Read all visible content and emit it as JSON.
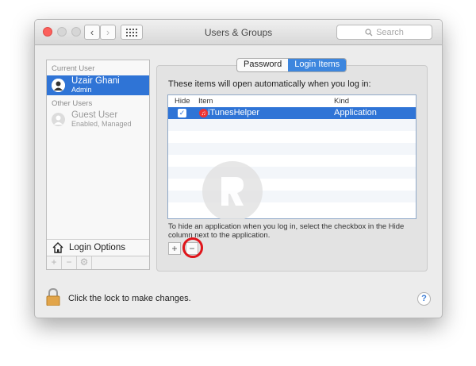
{
  "window": {
    "title": "Users & Groups"
  },
  "toolbar": {
    "search_placeholder": "Search",
    "back_glyph": "‹",
    "forward_glyph": "›",
    "grid_glyph": "⋮⋮⋮"
  },
  "sidebar": {
    "current_user_heading": "Current User",
    "current_user": {
      "name": "Uzair Ghani",
      "role": "Admin"
    },
    "other_users_heading": "Other Users",
    "other_users": [
      {
        "name": "Guest User",
        "role": "Enabled, Managed"
      }
    ],
    "login_options_label": "Login Options",
    "add_glyph": "+",
    "remove_glyph": "−",
    "gear_glyph": "⚙"
  },
  "tabs": [
    {
      "label": "Password",
      "active": false
    },
    {
      "label": "Login Items",
      "active": true
    }
  ],
  "login_items": {
    "intro": "These items will open automatically when you log in:",
    "columns": {
      "hide": "Hide",
      "item": "Item",
      "kind": "Kind"
    },
    "rows": [
      {
        "hidden": true,
        "name": "iTunesHelper",
        "kind": "Application"
      }
    ],
    "hint": "To hide an application when you log in, select the checkbox in the Hide column next to the application.",
    "add_glyph": "+",
    "remove_glyph": "−"
  },
  "footer": {
    "lock_text": "Click the lock to make changes.",
    "help_glyph": "?"
  },
  "colors": {
    "selection": "#2f74d6",
    "highlight_circle": "#e0151b",
    "close_button": "#fc605c"
  }
}
